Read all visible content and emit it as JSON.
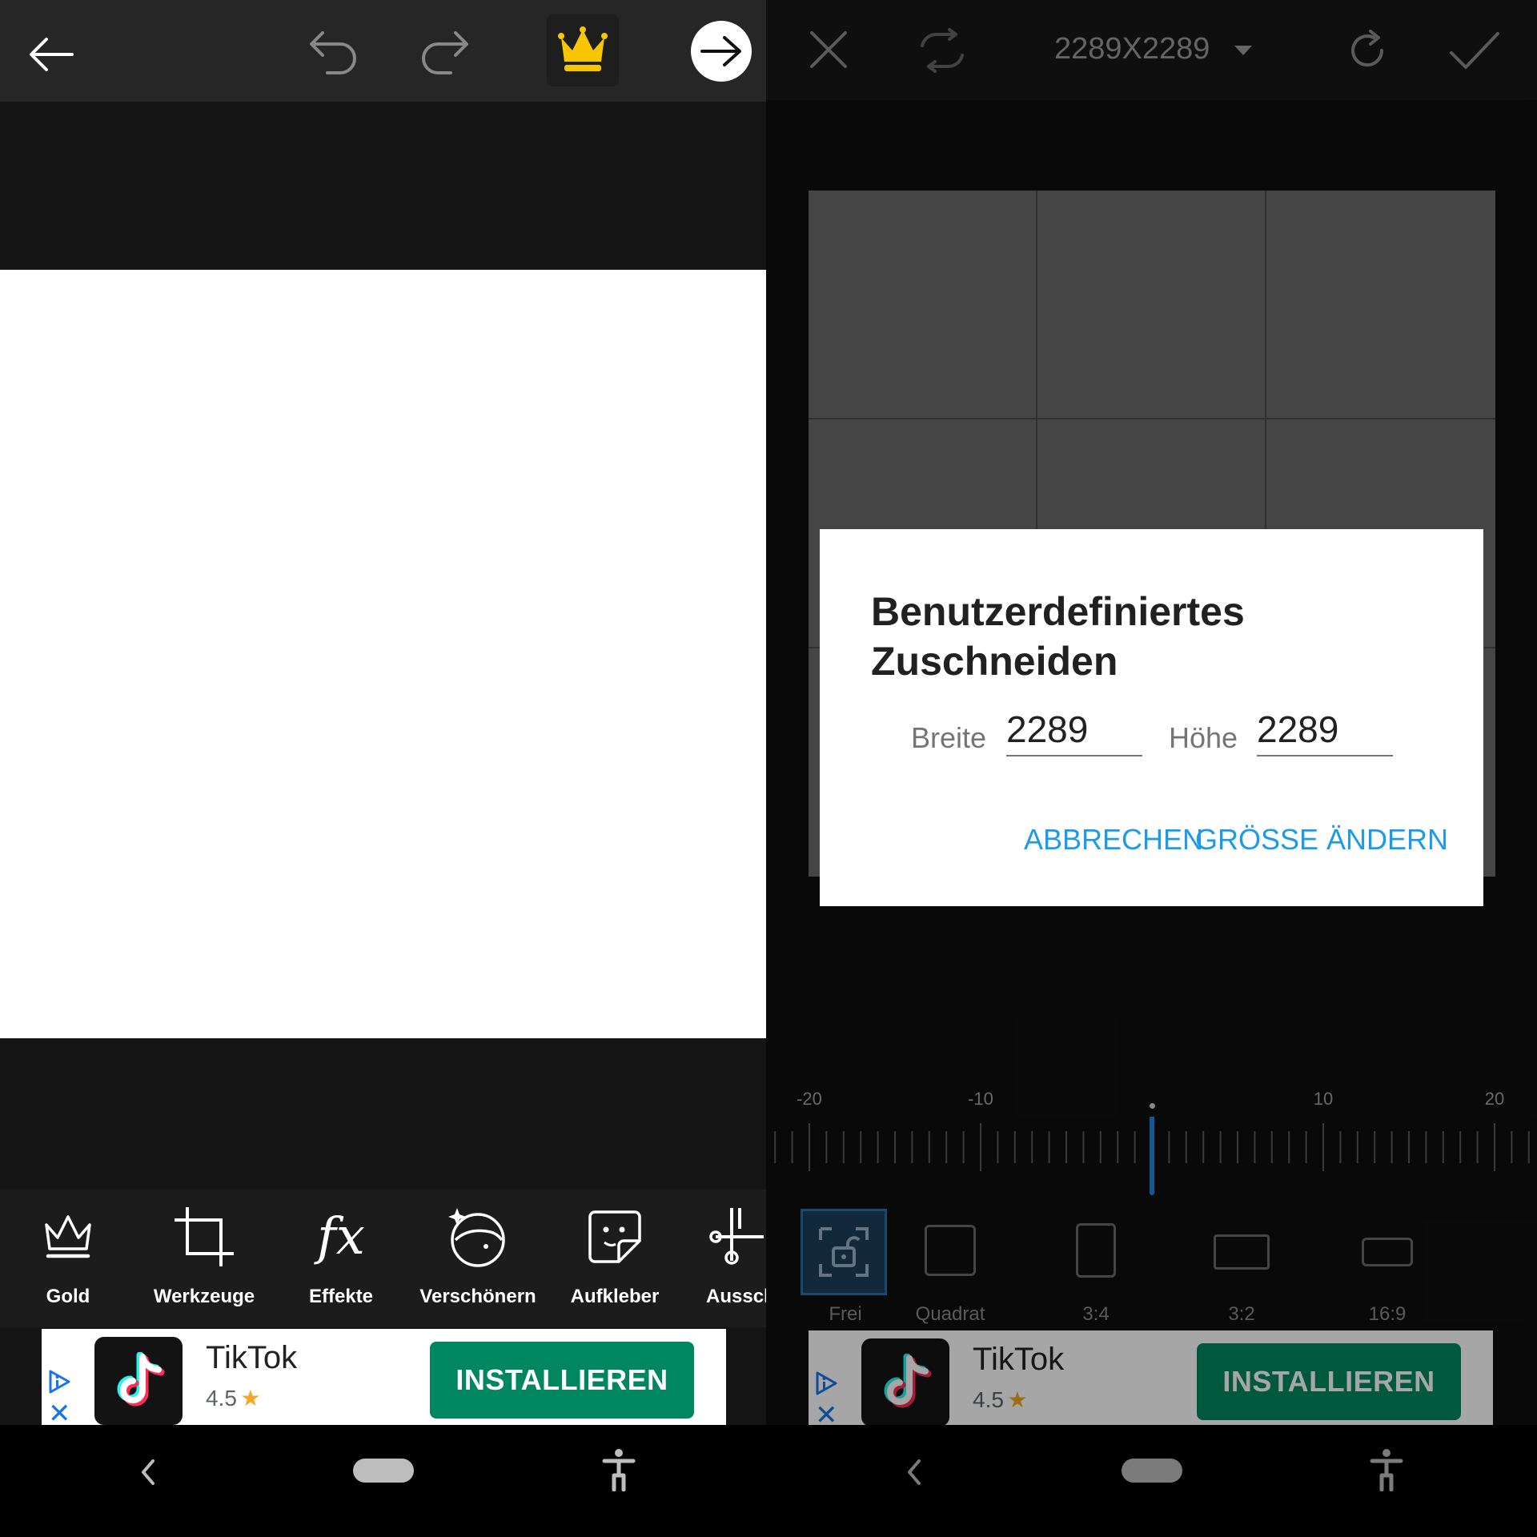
{
  "left": {
    "tools": [
      {
        "label": "Gold",
        "icon": "crown-outline-icon"
      },
      {
        "label": "Werkzeuge",
        "icon": "crop-icon"
      },
      {
        "label": "Effekte",
        "icon": "fx-icon"
      },
      {
        "label": "Verschönern",
        "icon": "face-sparkle-icon"
      },
      {
        "label": "Aufkleber",
        "icon": "sticker-icon"
      },
      {
        "label": "Aussch",
        "icon": "cutout-icon"
      }
    ],
    "fx_glyph": "fx",
    "ad": {
      "app_name": "TikTok",
      "rating": "4.5",
      "star": "★",
      "install_label": "INSTALLIEREN",
      "close_glyph": "✕"
    }
  },
  "right": {
    "size_label": "2289X2289",
    "dialog": {
      "title": "Benutzerdefiniertes Zuschneiden",
      "width_label": "Breite",
      "width_value": "2289",
      "height_label": "Höhe",
      "height_value": "2289",
      "cancel_label": "ABBRECHEN",
      "resize_label": "GRÖSSE ÄNDERN"
    },
    "ruler": {
      "labels": [
        "-20",
        "-10",
        "10",
        "20"
      ],
      "value": 0,
      "range": [
        -20,
        20
      ]
    },
    "ratios": [
      {
        "label": "Frei",
        "selected": true
      },
      {
        "label": "Quadrat",
        "selected": false
      },
      {
        "label": "3:4",
        "selected": false
      },
      {
        "label": "3:2",
        "selected": false
      },
      {
        "label": "16:9",
        "selected": false
      }
    ],
    "ad": {
      "app_name": "TikTok",
      "rating": "4.5",
      "star": "★",
      "install_label": "INSTALLIEREN",
      "close_glyph": "✕"
    }
  },
  "colors": {
    "premium_gold": "#f7c600",
    "install_green": "#01875f",
    "dialog_button_blue": "#1e9be6",
    "ruler_indicator_blue": "#1e88e5"
  }
}
